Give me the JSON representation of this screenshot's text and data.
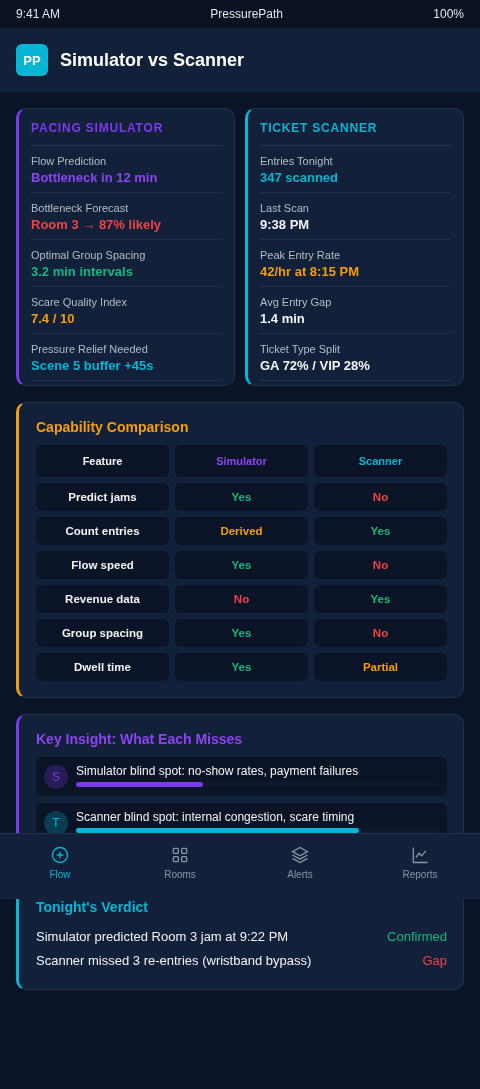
{
  "status_bar": {
    "time": "9:41 AM",
    "app": "PressurePath",
    "battery": "100%"
  },
  "header": {
    "logo": "PP",
    "title": "Simulator vs Scanner"
  },
  "panels": [
    {
      "title": "PACING SIMULATOR",
      "color": "#7c3aed",
      "metrics": [
        {
          "label": "Flow Prediction",
          "value": "Bottleneck in 12 min",
          "color": "#8b45f0"
        },
        {
          "label": "Bottleneck Forecast",
          "value": "Room 3 → 87% likely",
          "color": "#ef4444"
        },
        {
          "label": "Optimal Group Spacing",
          "value": "3.2 min intervals",
          "color": "#10b981"
        },
        {
          "label": "Scare Quality Index",
          "value": "7.4 / 10",
          "color": "#f59e0b"
        },
        {
          "label": "Pressure Relief Needed",
          "value": "Scene 5 buffer +45s",
          "color": "#06b6d4"
        }
      ]
    },
    {
      "title": "TICKET SCANNER",
      "color": "#06b6d4",
      "metrics": [
        {
          "label": "Entries Tonight",
          "value": "347 scanned",
          "color": "#06b6d4"
        },
        {
          "label": "Last Scan",
          "value": "9:38 PM",
          "color": "#f3f4f6"
        },
        {
          "label": "Peak Entry Rate",
          "value": "42/hr at 8:15 PM",
          "color": "#f59e0b"
        },
        {
          "label": "Avg Entry Gap",
          "value": "1.4 min",
          "color": "#f3f4f6"
        },
        {
          "label": "Ticket Type Split",
          "value": "GA 72% / VIP 28%",
          "color": "#f3f4f6"
        }
      ]
    }
  ],
  "comparison": {
    "title": "Capability Comparison",
    "columns": [
      {
        "label": "Feature",
        "color": "#f3f4f6"
      },
      {
        "label": "Simulator",
        "color": "#8b45f0"
      },
      {
        "label": "Scanner",
        "color": "#06b6d4"
      }
    ],
    "rows": [
      [
        {
          "text": "Predict jams",
          "color": "#f3f4f6"
        },
        {
          "text": "Yes",
          "color": "#10b981"
        },
        {
          "text": "No",
          "color": "#ef4444"
        }
      ],
      [
        {
          "text": "Count entries",
          "color": "#f3f4f6"
        },
        {
          "text": "Derived",
          "color": "#f59e0b"
        },
        {
          "text": "Yes",
          "color": "#10b981"
        }
      ],
      [
        {
          "text": "Flow speed",
          "color": "#f3f4f6"
        },
        {
          "text": "Yes",
          "color": "#10b981"
        },
        {
          "text": "No",
          "color": "#ef4444"
        }
      ],
      [
        {
          "text": "Revenue data",
          "color": "#f3f4f6"
        },
        {
          "text": "No",
          "color": "#ef4444"
        },
        {
          "text": "Yes",
          "color": "#10b981"
        }
      ],
      [
        {
          "text": "Group spacing",
          "color": "#f3f4f6"
        },
        {
          "text": "Yes",
          "color": "#10b981"
        },
        {
          "text": "No",
          "color": "#ef4444"
        }
      ],
      [
        {
          "text": "Dwell time",
          "color": "#f3f4f6"
        },
        {
          "text": "Yes",
          "color": "#10b981"
        },
        {
          "text": "Partial",
          "color": "#f59e0b"
        }
      ]
    ]
  },
  "insight": {
    "title": "Key Insight: What Each Misses",
    "items": [
      {
        "avatar": "S",
        "text": "Simulator blind spot: no-show rates, payment failures",
        "color": "#7c3aed",
        "level": 0.35
      },
      {
        "avatar": "T",
        "text": "Scanner blind spot: internal congestion, scare timing",
        "color": "#06b6d4",
        "level": 0.78
      }
    ]
  },
  "verdict": {
    "title": "Tonight's Verdict",
    "rows": [
      {
        "text": "Simulator predicted Room 3 jam at 9:22 PM",
        "result": "Confirmed",
        "color": "#10b981"
      },
      {
        "text": "Scanner missed 3 re-entries (wristband bypass)",
        "result": "Gap",
        "color": "#ef4444"
      }
    ]
  },
  "nav": [
    {
      "label": "Flow",
      "selected": true
    },
    {
      "label": "Rooms",
      "selected": false
    },
    {
      "label": "Alerts",
      "selected": false
    },
    {
      "label": "Reports",
      "selected": false
    }
  ]
}
